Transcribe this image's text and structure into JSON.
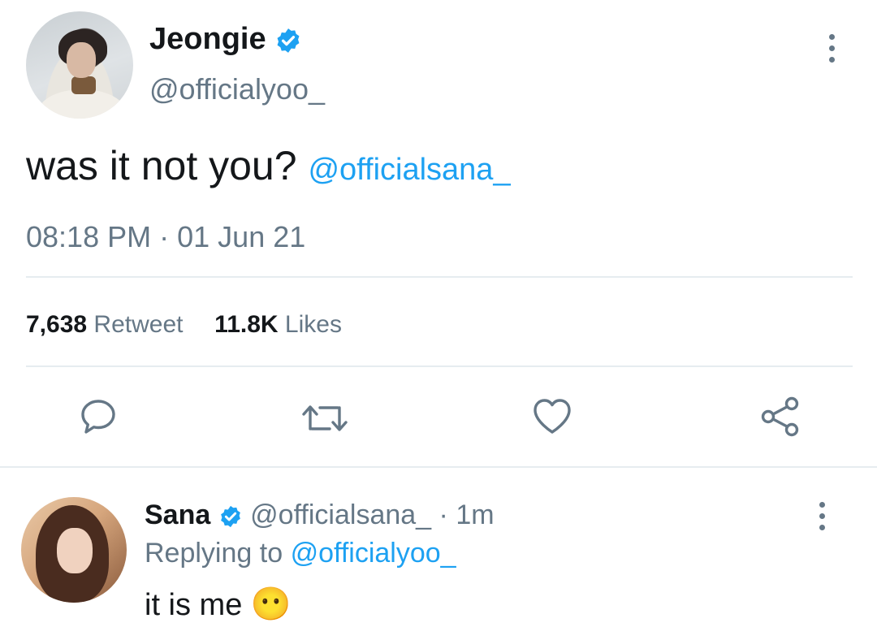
{
  "tweet": {
    "author_name": "Jeongie",
    "author_handle": "@officialyoo_",
    "text": "was it not you?",
    "mention": "@officialsana_",
    "time": "08:18 PM",
    "separator": "·",
    "date": "01 Jun 21"
  },
  "stats": {
    "retweets_count": "7,638",
    "retweets_label": "Retweet",
    "likes_count": "11.8K",
    "likes_label": "Likes"
  },
  "actions": {
    "icons": [
      "reply-icon",
      "retweet-icon",
      "like-icon",
      "share-icon"
    ]
  },
  "reply": {
    "author_name": "Sana",
    "author_handle": "@officialsana_",
    "separator": "·",
    "age": "1m",
    "replying_to_label": "Replying to",
    "replying_to_handle": "@officialyoo_",
    "text": "it is me",
    "emoji": "😶"
  },
  "colors": {
    "accent": "#1da1f2",
    "verified": "#1da1f2",
    "muted": "#657786",
    "text": "#14171a",
    "divider": "#e6ecf0"
  }
}
